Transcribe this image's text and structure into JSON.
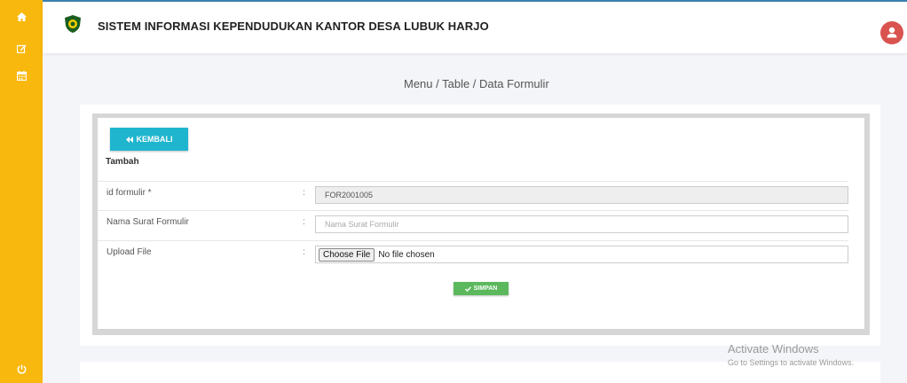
{
  "header": {
    "title": "SISTEM INFORMASI KEPENDUDUKAN KANTOR DESA LUBUK HARJO"
  },
  "breadcrumb": "Menu / Table / Data Formulir",
  "form": {
    "back_label": "KEMBALI",
    "section_title": "Tambah",
    "fields": [
      {
        "label": "id formulir  *",
        "colon": ":",
        "value": "FOR2001005"
      },
      {
        "label": "Nama Surat Formulir",
        "colon": ":",
        "placeholder": "Nama Surat Formulir"
      },
      {
        "label": "Upload File",
        "colon": ":",
        "button": "Choose File",
        "status": "No file chosen"
      }
    ],
    "save_label": "SIMPAN"
  },
  "watermark": {
    "line1": "Activate Windows",
    "line2": "Go to Settings to activate Windows."
  },
  "colors": {
    "sidebar": "#f9b80e",
    "back_button": "#1fb5cf",
    "save_button": "#5cb85c",
    "avatar": "#d9534f"
  },
  "icons": {
    "sidebar": [
      "home-icon",
      "edit-icon",
      "calendar-icon",
      "power-icon"
    ],
    "header": [
      "logo-icon",
      "user-icon"
    ]
  }
}
